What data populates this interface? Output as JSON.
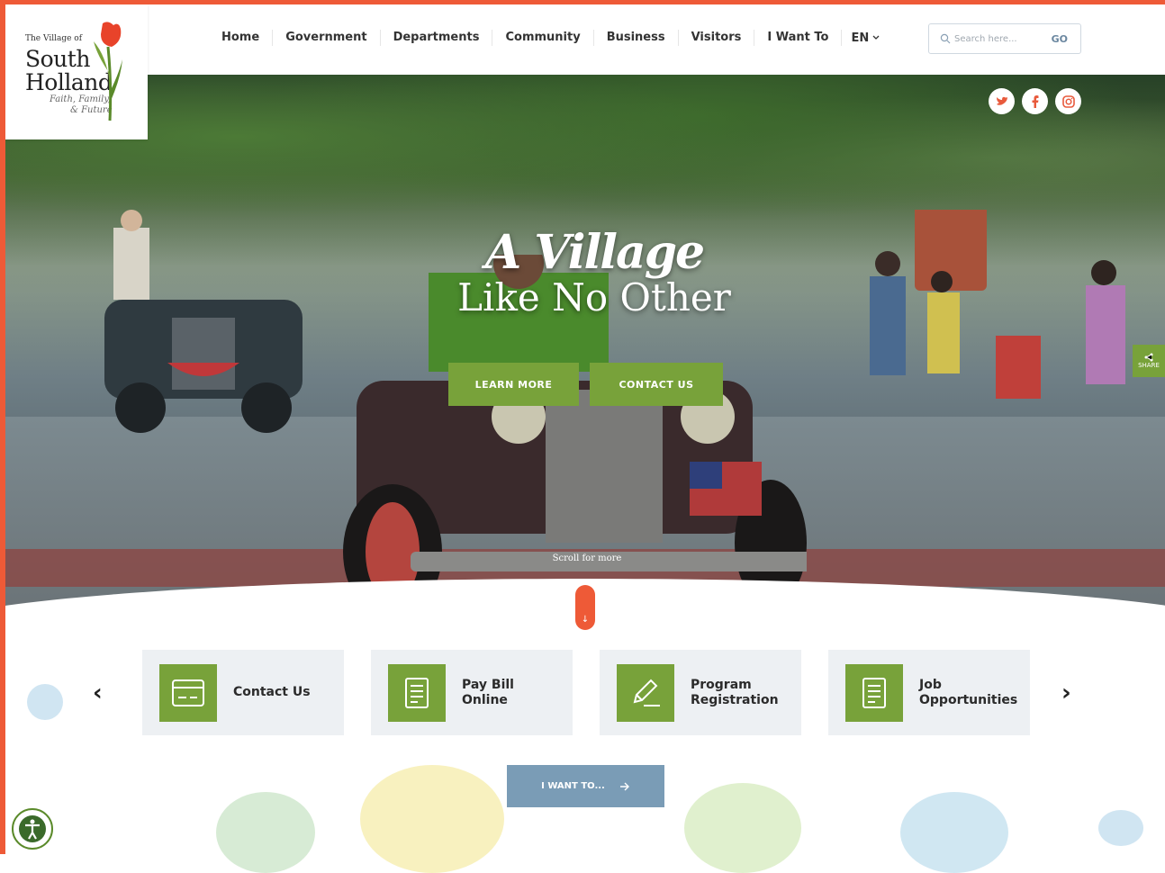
{
  "logo": {
    "small": "The Village of",
    "line1": "South",
    "line2": "Holland",
    "tag1": "Faith, Family,",
    "tag2": "& Future"
  },
  "nav": {
    "items": [
      "Home",
      "Government",
      "Departments",
      "Community",
      "Business",
      "Visitors",
      "I Want To"
    ],
    "lang": "EN"
  },
  "search": {
    "placeholder": "Search here...",
    "go": "GO"
  },
  "hero": {
    "line1": "A Village",
    "line2": "Like No Other",
    "learn_more": "LEARN MORE",
    "contact_us": "CONTACT US",
    "scroll": "Scroll for more",
    "share": "SHARE"
  },
  "social": [
    "twitter-icon",
    "facebook-icon",
    "instagram-icon"
  ],
  "quick_links": [
    {
      "label_1": "Contact Us",
      "label_2": "",
      "icon": "card-icon"
    },
    {
      "label_1": "Pay Bill",
      "label_2": "Online",
      "icon": "document-icon"
    },
    {
      "label_1": "Program",
      "label_2": "Registration",
      "icon": "pencil-icon"
    },
    {
      "label_1": "Job",
      "label_2": "Opportunities",
      "icon": "document-icon"
    }
  ],
  "iwant": {
    "label": "I WANT TO..."
  },
  "colors": {
    "accent_green": "#78a23a",
    "accent_orange": "#ee5a37",
    "button_blue": "#7a9cb6"
  }
}
